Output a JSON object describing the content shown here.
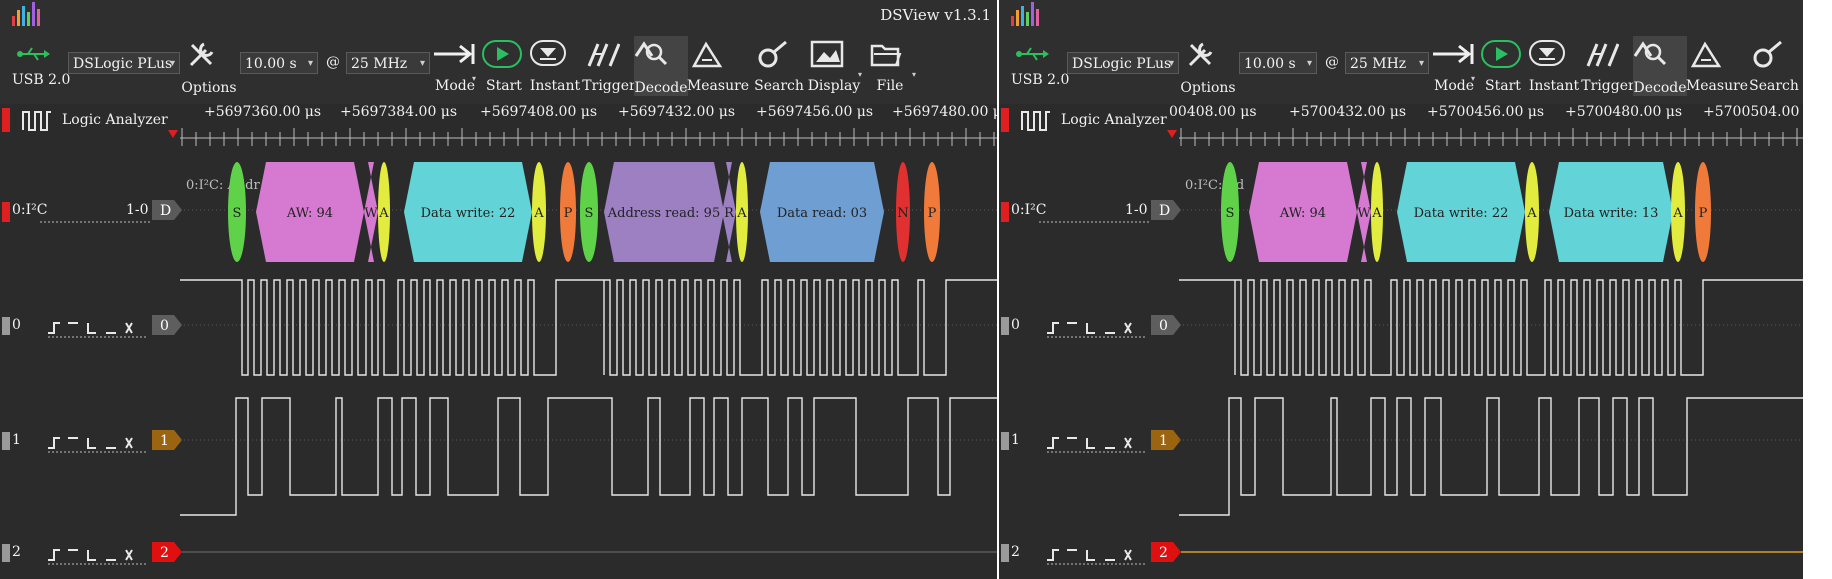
{
  "left": {
    "version": "DSView v1.3.1",
    "usb_label": "USB 2.0",
    "device": "DSLogic PLus",
    "options_label": "Options",
    "duration": "10.00 s",
    "at": "@",
    "rate": "25 MHz",
    "toolbar": [
      "Mode",
      "Start",
      "Instant",
      "Trigger",
      "Decode",
      "Measure",
      "Search",
      "Display",
      "File"
    ],
    "analyzer_label": "Logic Analyzer",
    "ruler": [
      "+5697360.00 μs",
      "+5697384.00 μs",
      "+5697408.00 μs",
      "+5697432.00 μs",
      "+5697456.00 μs",
      "+5697480.00 μs"
    ],
    "decoder": {
      "name": "0:I²C",
      "range": "1-0",
      "tag": "D",
      "ghost": "0:I²C: Addr"
    },
    "annotations": [
      "S",
      "AW: 94",
      "W",
      "A",
      "Data write: 22",
      "A",
      "P",
      "S",
      "Address read: 95",
      "R",
      "A",
      "Data read: 03",
      "N",
      "P"
    ],
    "channels": [
      "0",
      "1",
      "2"
    ]
  },
  "right": {
    "usb_label": "USB 2.0",
    "device": "DSLogic PLus",
    "options_label": "Options",
    "duration": "10.00 s",
    "at": "@",
    "rate": "25 MHz",
    "toolbar": [
      "Mode",
      "Start",
      "Instant",
      "Trigger",
      "Decode",
      "Measure",
      "Search"
    ],
    "analyzer_label": "Logic Analyzer",
    "ruler": [
      "00408.00 μs",
      "+5700432.00 μs",
      "+5700456.00 μs",
      "+5700480.00 μs",
      "+5700504.00 μs"
    ],
    "decoder": {
      "name": "0:I²C",
      "range": "1-0",
      "tag": "D",
      "ghost": "0:I²C: Ad"
    },
    "annotations": [
      "S",
      "AW: 94",
      "W",
      "A",
      "Data write: 22",
      "A",
      "Data write: 13",
      "A",
      "P"
    ],
    "channels": [
      "0",
      "1",
      "2"
    ]
  },
  "colors": {
    "bg": "#2b2b2b",
    "start": "#5fd24a",
    "addr": "#d57ad0",
    "data": "#62d3d6",
    "ack": "#e2ec3f",
    "stop": "#f07a3a",
    "addr_read": "#9d80c2",
    "data_read": "#6f9fd2",
    "nack": "#e03030",
    "ch0": "#5e5e5e",
    "ch1": "#9a6410",
    "ch2": "#e01010"
  }
}
